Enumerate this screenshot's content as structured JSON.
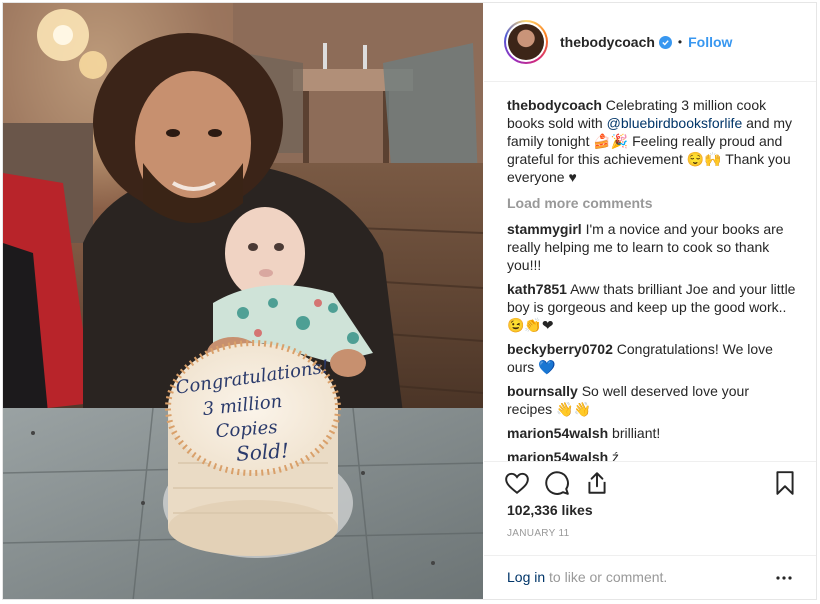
{
  "post": {
    "username": "thebodycoach",
    "follow_label": "Follow",
    "dot": "•",
    "caption_text": "Celebrating 3 million cook books sold with",
    "caption_mention": "@bluebirdbooksforlife",
    "caption_text_2": "and my family tonight 🍰🎉 Feeling really proud and grateful for this achievement 😌🙌 Thank you everyone ♥",
    "load_more": "Load more comments",
    "likes": "102,336 likes",
    "date": "JANUARY 11",
    "login_link": "Log in",
    "login_rest": " to like or comment.",
    "photo_alt_cake_text": [
      "Congratulations!",
      "3 million",
      "Copies",
      "Sold!"
    ]
  },
  "comments": [
    {
      "user": "stammygirl",
      "text": "I'm a novice and your books are really helping me to learn to cook so thank you!!!"
    },
    {
      "user": "kath7851",
      "text": "Aww thats brilliant Joe and your little boy is gorgeous and keep up the good work..😉👏❤"
    },
    {
      "user": "beckyberry0702",
      "text": "Congratulations! We love ours 💙"
    },
    {
      "user": "bournsally",
      "text": "So well deserved love your recipes 👋👋"
    },
    {
      "user": "marion54walsh",
      "text": "brilliant!"
    },
    {
      "user": "marion54walsh",
      "text": "ź"
    }
  ],
  "colors": {
    "link_blue": "#3897f0",
    "mention_blue": "#003569",
    "muted_gray": "#999999",
    "text": "#262626"
  },
  "icons": {
    "like": "heart-icon",
    "comment": "comment-icon",
    "share": "share-icon",
    "save": "bookmark-icon",
    "more": "more-options-icon",
    "verified": "verified-badge-icon"
  }
}
